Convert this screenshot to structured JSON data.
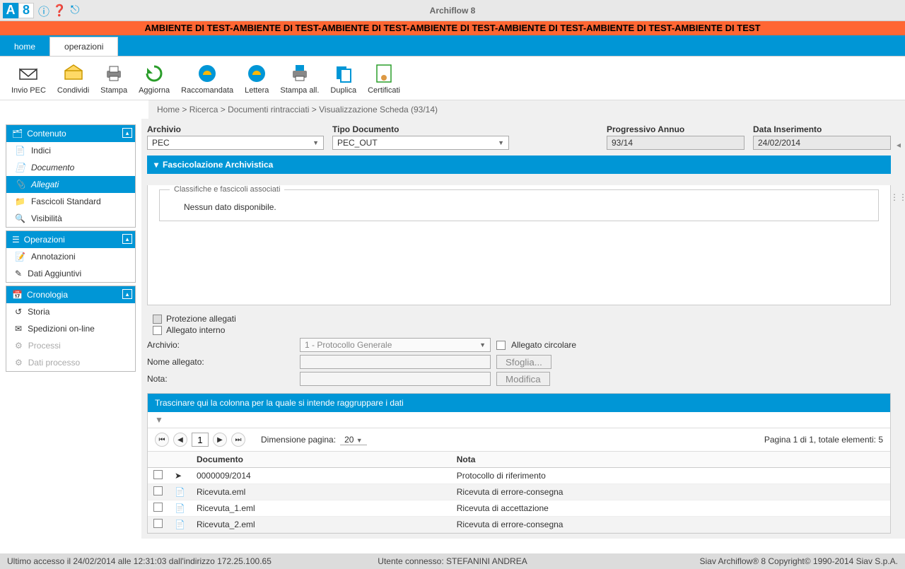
{
  "app": {
    "title": "Archiflow 8"
  },
  "banner": "AMBIENTE DI TEST-AMBIENTE DI TEST-AMBIENTE DI TEST-AMBIENTE DI TEST-AMBIENTE DI TEST-AMBIENTE DI TEST-AMBIENTE DI TEST",
  "tabs": {
    "home": "home",
    "operations": "operazioni"
  },
  "toolbar": {
    "inviopec": "Invio PEC",
    "condividi": "Condividi",
    "stampa": "Stampa",
    "aggiorna": "Aggiorna",
    "raccomandata": "Raccomandata",
    "lettera": "Lettera",
    "stampaall": "Stampa all.",
    "duplica": "Duplica",
    "certificati": "Certificati"
  },
  "breadcrumb": {
    "home": "Home",
    "search": "Ricerca",
    "docs": "Documenti rintracciati",
    "current": "Visualizzazione Scheda (93/14)"
  },
  "sidebar": {
    "content_hdr": "Contenuto",
    "indici": "Indici",
    "documento": "Documento",
    "allegati": "Allegati",
    "fascicoli": "Fascicoli Standard",
    "visibilita": "Visibilità",
    "operazioni_hdr": "Operazioni",
    "annotazioni": "Annotazioni",
    "datiagg": "Dati Aggiuntivi",
    "cronologia_hdr": "Cronologia",
    "storia": "Storia",
    "spedizioni": "Spedizioni on-line",
    "processi": "Processi",
    "datiprocesso": "Dati processo"
  },
  "fields": {
    "archivio_lbl": "Archivio",
    "archivio_val": "PEC",
    "tipodoc_lbl": "Tipo Documento",
    "tipodoc_val": "PEC_OUT",
    "progannuo_lbl": "Progressivo Annuo",
    "progannuo_val": "93/14",
    "datains_lbl": "Data Inserimento",
    "datains_val": "24/02/2014"
  },
  "fascicolazione": {
    "header": "Fascicolazione Archivistica",
    "legend": "Classifiche e fascicoli associati",
    "empty": "Nessun dato disponibile."
  },
  "allegati": {
    "protezione": "Protezione allegati",
    "interno": "Allegato interno",
    "archivio_lbl": "Archivio:",
    "archivio_ddl": "1 - Protocollo Generale",
    "circolare": "Allegato circolare",
    "nome_lbl": "Nome allegato:",
    "sfoglia": "Sfoglia...",
    "nota_lbl": "Nota:",
    "modifica": "Modifica"
  },
  "grid": {
    "group_text": "Trascinare qui la colonna per la quale si intende raggruppare i dati",
    "pager": {
      "page": "1",
      "dim_lbl": "Dimensione pagina:",
      "dim_val": "20",
      "info": "Pagina 1 di 1, totale elementi: 5"
    },
    "columns": {
      "doc": "Documento",
      "nota": "Nota"
    },
    "rows": [
      {
        "doc": "0000009/2014",
        "nota": "Protocollo di riferimento"
      },
      {
        "doc": "Ricevuta.eml",
        "nota": "Ricevuta di errore-consegna"
      },
      {
        "doc": "Ricevuta_1.eml",
        "nota": "Ricevuta di accettazione"
      },
      {
        "doc": "Ricevuta_2.eml",
        "nota": "Ricevuta di errore-consegna"
      }
    ]
  },
  "status": {
    "left": "Ultimo accesso il 24/02/2014 alle 12:31:03 dall'indirizzo 172.25.100.65",
    "center": "Utente connesso: STEFANINI ANDREA",
    "right": "Siav Archiflow® 8 Copyright© 1990-2014 Siav S.p.A."
  }
}
